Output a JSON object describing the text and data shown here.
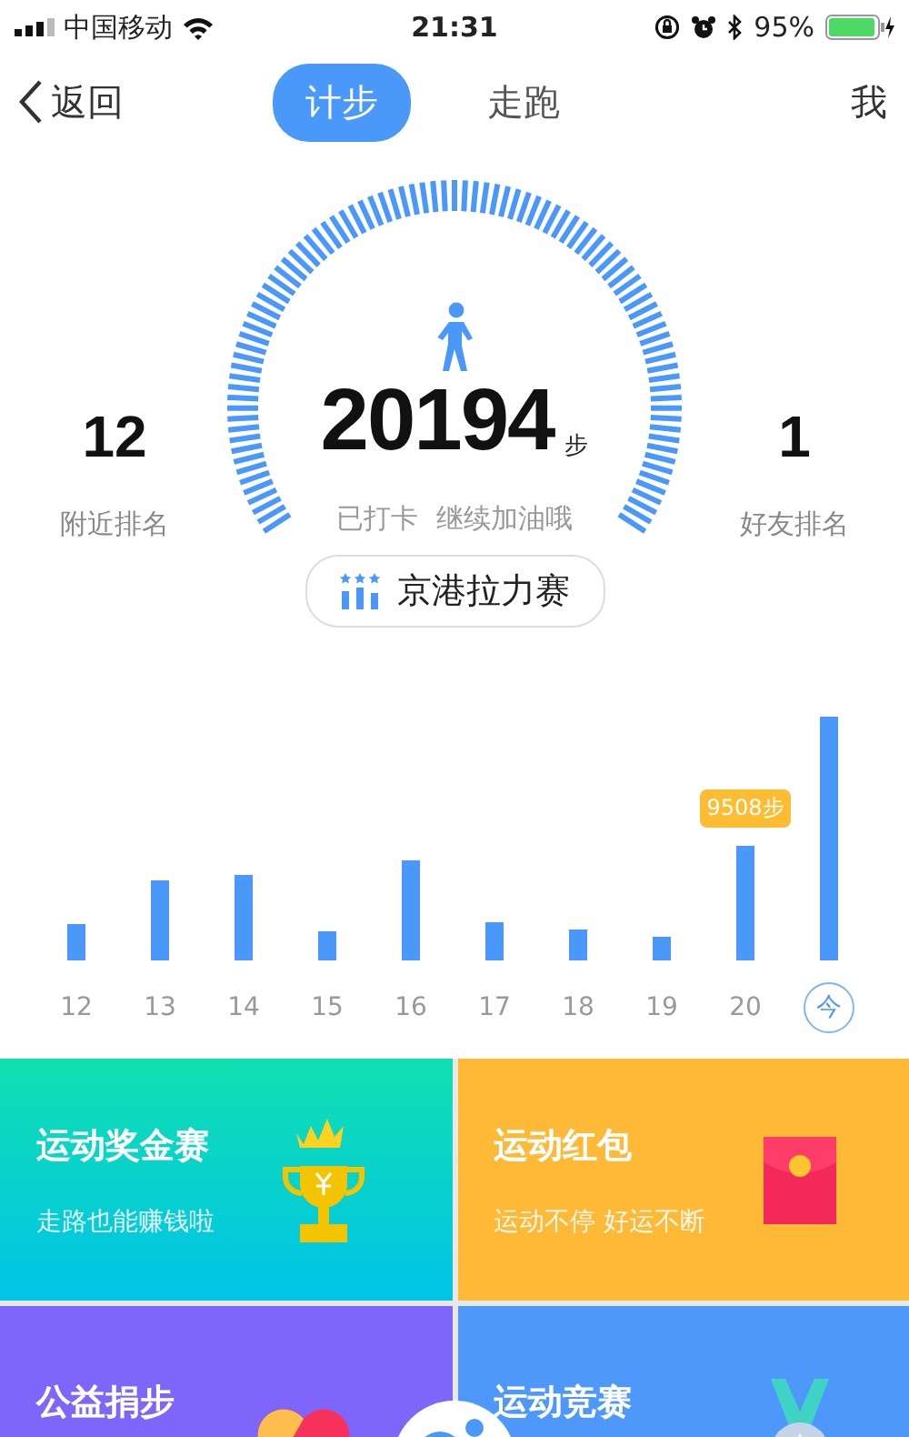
{
  "status_bar": {
    "carrier": "中国移动",
    "time": "21:31",
    "battery": "95%"
  },
  "nav": {
    "back": "返回",
    "tabs": [
      {
        "label": "计步",
        "selected": true
      },
      {
        "label": "走跑",
        "selected": false
      }
    ],
    "me": "我"
  },
  "summary": {
    "left": {
      "value": "12",
      "label": "附近排名"
    },
    "steps": "20194",
    "unit": "步",
    "message": "已打卡  继续加油哦",
    "right": {
      "value": "1",
      "label": "好友排名"
    },
    "event": "京港拉力赛"
  },
  "days": [
    {
      "label": "12",
      "selected": false
    },
    {
      "label": "13",
      "selected": false
    },
    {
      "label": "14",
      "selected": false
    },
    {
      "label": "15",
      "selected": false
    },
    {
      "label": "16",
      "selected": false
    },
    {
      "label": "17",
      "selected": false
    },
    {
      "label": "18",
      "selected": false
    },
    {
      "label": "19",
      "selected": false
    },
    {
      "label": "20",
      "selected": false,
      "tooltip": "9508步"
    },
    {
      "label": "今",
      "selected": true
    }
  ],
  "tiles": [
    {
      "kind": "trophy",
      "title": "运动奖金赛",
      "subtitle": "走路也能赚钱啦"
    },
    {
      "kind": "red-packet",
      "title": "运动红包",
      "subtitle": "运动不停 好运不断"
    },
    {
      "kind": "heart",
      "title": "公益捐步"
    },
    {
      "kind": "medal",
      "title": "运动竞赛"
    }
  ]
}
